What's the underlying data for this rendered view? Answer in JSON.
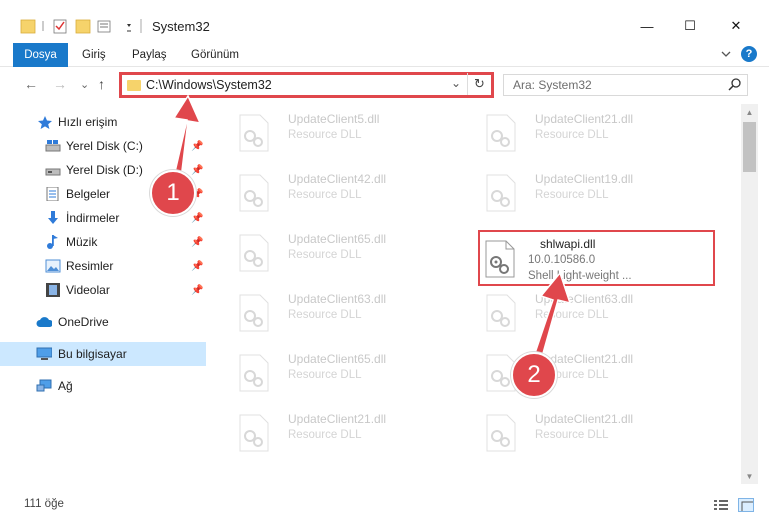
{
  "window": {
    "title": "System32",
    "controls": {
      "minimize": "—",
      "maximize": "☐",
      "close": "✕"
    }
  },
  "ribbon": {
    "file_tab": "Dosya",
    "tabs": [
      "Giriş",
      "Paylaş",
      "Görünüm"
    ],
    "collapse_icon": "chevron-down-icon",
    "help_icon": "help-icon",
    "help_glyph": "?"
  },
  "address_bar": {
    "path": "C:\\Windows\\System32",
    "dropdown_glyph": "⌄",
    "refresh_glyph": "↻"
  },
  "search": {
    "placeholder": "Ara: System32",
    "icon": "search-icon"
  },
  "navigation": {
    "back": "←",
    "forward": "→",
    "recent": "⌄",
    "up": "↑"
  },
  "sidebar": {
    "items": [
      {
        "label": "Hızlı erişim",
        "icon": "star-icon",
        "pinned": false
      },
      {
        "label": "Yerel Disk (C:)",
        "icon": "drive-icon",
        "pinned": true
      },
      {
        "label": "Yerel Disk (D:)",
        "icon": "drive-icon",
        "pinned": true
      },
      {
        "label": "Belgeler",
        "icon": "documents-icon",
        "pinned": true
      },
      {
        "label": "İndirmeler",
        "icon": "download-icon",
        "pinned": true
      },
      {
        "label": "Müzik",
        "icon": "music-icon",
        "pinned": true
      },
      {
        "label": "Resimler",
        "icon": "pictures-icon",
        "pinned": true
      },
      {
        "label": "Videolar",
        "icon": "videos-icon",
        "pinned": true
      },
      {
        "label": "OneDrive",
        "icon": "cloud-icon",
        "pinned": false
      },
      {
        "label": "Bu bilgisayar",
        "icon": "computer-icon",
        "pinned": false,
        "selected": true
      },
      {
        "label": "Ağ",
        "icon": "network-icon",
        "pinned": false
      }
    ]
  },
  "files": {
    "left": [
      {
        "name": "UpdateClient5.dll",
        "desc": "Resource DLL"
      },
      {
        "name": "UpdateClient42.dll",
        "desc": "Resource DLL"
      },
      {
        "name": "UpdateClient65.dll",
        "desc": "Resource DLL"
      },
      {
        "name": "UpdateClient63.dll",
        "desc": "Resource DLL"
      },
      {
        "name": "UpdateClient65.dll",
        "desc": "Resource DLL"
      },
      {
        "name": "UpdateClient21.dll",
        "desc": "Resource DLL"
      }
    ],
    "right": [
      {
        "name": "UpdateClient21.dll",
        "desc": "Resource DLL"
      },
      {
        "name": "UpdateClient19.dll",
        "desc": "Resource DLL"
      },
      {
        "name": "UpdateClient63.dll",
        "desc": "Resource DLL"
      },
      {
        "name": "UpdateClient21.dll",
        "desc": "Resource DLL"
      },
      {
        "name": "UpdateClient21.dll",
        "desc": "Resource DLL"
      }
    ],
    "highlighted": {
      "name": "shlwapi.dll",
      "version": "10.0.10586.0",
      "desc": "Shell Light-weight ..."
    }
  },
  "status": {
    "count": "111 öğe"
  },
  "annotations": {
    "step1": "1",
    "step2": "2",
    "color": "#e0474c"
  }
}
